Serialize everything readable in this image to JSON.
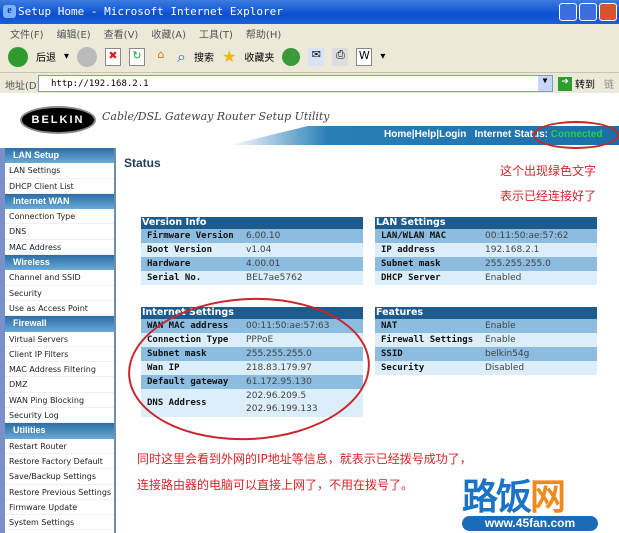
{
  "window": {
    "title": "Setup Home - Microsoft Internet Explorer"
  },
  "menu": [
    "文件(F)",
    "编辑(E)",
    "查看(V)",
    "收藏(A)",
    "工具(T)",
    "帮助(H)"
  ],
  "toolbar": {
    "back": "后退",
    "search": "搜索",
    "favorites": "收藏夹"
  },
  "address": {
    "label": "地址(D)",
    "url": "http://192.168.2.1",
    "go": "转到",
    "links": "链"
  },
  "header": {
    "logo": "BELKIN",
    "tagline": "Cable/DSL Gateway Router Setup Utility",
    "home": "Home",
    "help": "Help",
    "login": "Login",
    "status_label": "Internet Status:",
    "status_value": "Connected"
  },
  "sidebar": [
    {
      "header": "LAN Setup",
      "items": [
        "LAN Settings",
        "DHCP Client List"
      ]
    },
    {
      "header": "Internet WAN",
      "items": [
        "Connection Type",
        "DNS",
        "MAC Address"
      ]
    },
    {
      "header": "Wireless",
      "items": [
        "Channel and SSID",
        "Security",
        "Use as Access Point"
      ]
    },
    {
      "header": "Firewall",
      "items": [
        "Virtual Servers",
        "Client IP Filters",
        "MAC Address Filtering",
        "DMZ",
        "WAN Ping Blocking",
        "Security Log"
      ]
    },
    {
      "header": "Utilities",
      "items": [
        "Restart Router",
        "Restore Factory Default",
        "Save/Backup Settings",
        "Restore Previous Settings",
        "Firmware Update",
        "System Settings"
      ]
    }
  ],
  "page_title": "Status",
  "version_info": {
    "title": "Version Info",
    "rows": [
      [
        "Firmware Version",
        "6.00.10"
      ],
      [
        "Boot Version",
        "v1.04"
      ],
      [
        "Hardware",
        "4.00.01"
      ],
      [
        "Serial No.",
        "BEL7ae5762"
      ]
    ]
  },
  "lan_settings": {
    "title": "LAN Settings",
    "rows": [
      [
        "LAN/WLAN MAC",
        "00:11:50:ae:57:62"
      ],
      [
        "IP address",
        "192.168.2.1"
      ],
      [
        "Subnet mask",
        "255.255.255.0"
      ],
      [
        "DHCP Server",
        "Enabled"
      ]
    ]
  },
  "internet_settings": {
    "title": "Internet Settings",
    "rows": [
      [
        "WAN MAC address",
        "00:11:50:ae:57:63"
      ],
      [
        "Connection Type",
        "PPPoE"
      ],
      [
        "Subnet mask",
        "255.255.255.0"
      ],
      [
        "Wan IP",
        "218.83.179.97"
      ],
      [
        "Default gateway",
        "61.172.95.130"
      ]
    ],
    "dns_label": "DNS Address",
    "dns1": "202.96.209.5",
    "dns2": "202.96.199.133"
  },
  "features": {
    "title": "Features",
    "rows": [
      [
        "NAT",
        "Enable"
      ],
      [
        "Firewall Settings",
        "Enable"
      ],
      [
        "SSID",
        "belkin54g"
      ],
      [
        "Security",
        "Disabled"
      ]
    ]
  },
  "annotations": {
    "top1": "这个出现绿色文字",
    "top2": "表示已经连接好了",
    "bottom1": "同时这里会看到外网的IP地址等信息，就表示已经拨号成功了，",
    "bottom2": "连接路由器的电脑可以直接上网了，不用在拨号了。"
  },
  "watermark": {
    "cn_a": "路饭",
    "cn_b": "网",
    "url": "www.45fan.com"
  }
}
